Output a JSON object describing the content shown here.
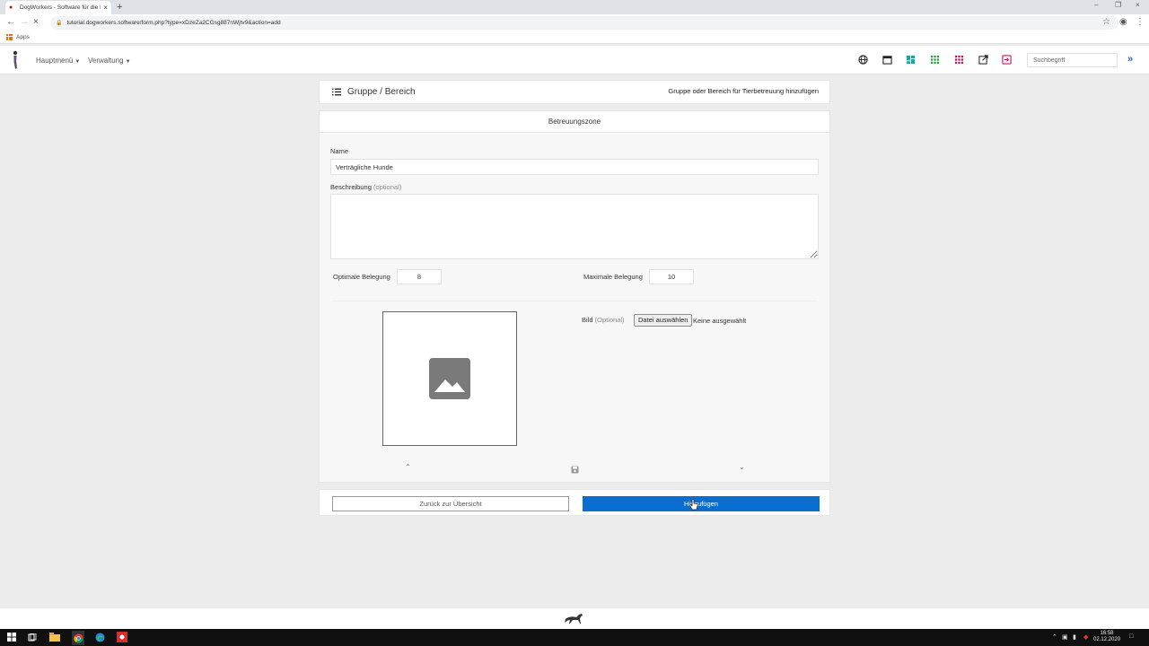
{
  "browser": {
    "tab_title": "DogWorkers - Software für die H...",
    "url": "tutorial.dogworkers.software/form.php?type=xDzeZa2CGsg887nWjtv9&action=add",
    "bookmarks_label": "Apps"
  },
  "navbar": {
    "menu_main": "Hauptmenü",
    "menu_admin": "Verwaltung",
    "search_placeholder": "Suchbegriff",
    "icon_colors": {
      "grid_teal": "#1fa3a3",
      "grid_green": "#2e9e3c",
      "grid_red": "#c2185b",
      "link_blue": "#1565c0"
    }
  },
  "header": {
    "title": "Gruppe / Bereich",
    "subtitle": "Gruppe oder Bereich für Tierbetreuung hinzufügen"
  },
  "form": {
    "section_title": "Betreuungszone",
    "name_label": "Name",
    "name_value": "Verträgliche Hunde",
    "description_label": "Beschreibung",
    "description_optional": "(optional)",
    "optimal_label": "Optimale Belegung",
    "optimal_value": "8",
    "max_label": "Maximale Belegung",
    "max_value": "10",
    "image_label": "Bild",
    "image_optional": "(Optional)",
    "file_button": "Datei auswählen",
    "file_status": "Keine ausgewählt"
  },
  "buttons": {
    "back": "Zurück zur Übersicht",
    "add": "Hinzufügen",
    "add_color": "#0a6ed1"
  },
  "taskbar": {
    "time": "16:58",
    "date": "02.12.2020"
  }
}
